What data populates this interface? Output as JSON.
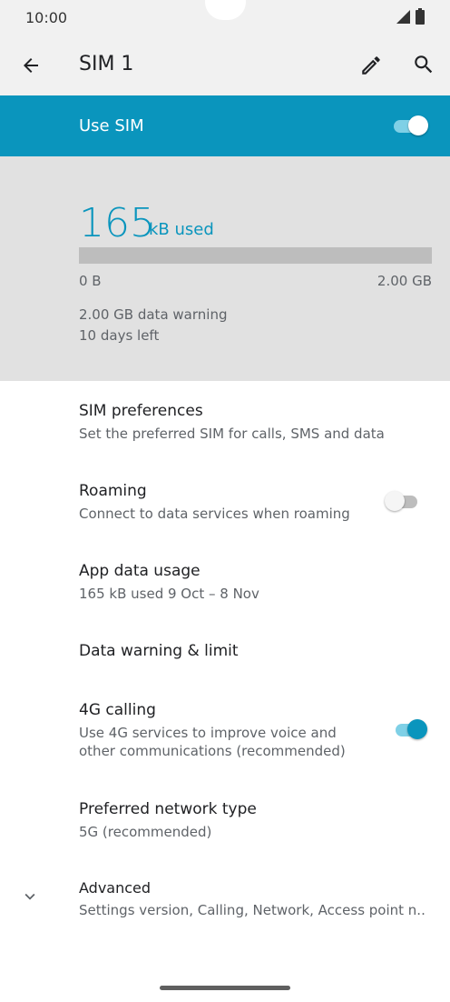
{
  "status_bar": {
    "time": "10:00",
    "icons": [
      "signal-icon",
      "battery-icon"
    ]
  },
  "toolbar": {
    "title": "SIM 1",
    "back_icon": "arrow-back-icon",
    "edit_icon": "pencil-icon",
    "search_icon": "search-icon"
  },
  "use_sim": {
    "label": "Use SIM",
    "enabled": true
  },
  "usage": {
    "amount": "165",
    "unit_label": "kB used",
    "bar_fill_fraction": 0.0,
    "min_label": "0 B",
    "max_label": "2.00 GB",
    "warning": "2.00 GB data warning",
    "days_left": "10 days left"
  },
  "items": [
    {
      "title": "SIM preferences",
      "subtitle": "Set the preferred SIM for calls, SMS and data"
    },
    {
      "title": "Roaming",
      "subtitle": "Connect to data services when roaming",
      "toggle": false
    },
    {
      "title": "App data usage",
      "subtitle": "165 kB used 9 Oct – 8 Nov"
    },
    {
      "title": "Data warning & limit"
    },
    {
      "title": "4G calling",
      "subtitle_line1": "Use 4G services to improve voice and",
      "subtitle_line2": "other communications (recommended)",
      "toggle": true
    },
    {
      "title": "Preferred network type",
      "subtitle": "5G (recommended)"
    },
    {
      "title": "Advanced",
      "subtitle": "Settings version, Calling, Network, Access point n..",
      "icon": "chevron-down-icon"
    }
  ],
  "colors": {
    "accent": "#0a95bd",
    "header_bg": "#f1f1f1",
    "usage_bg": "#e1e1e1"
  }
}
